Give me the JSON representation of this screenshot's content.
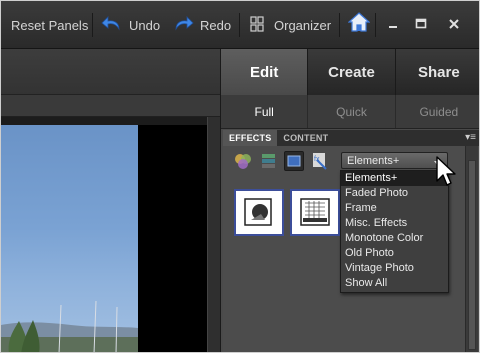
{
  "toolbar": {
    "reset_panels": "Reset Panels",
    "undo": "Undo",
    "redo": "Redo",
    "organizer": "Organizer",
    "icons": [
      "undo-icon",
      "redo-icon",
      "organizer-icon",
      "home-icon",
      "minimize-icon",
      "maximize-icon",
      "close-icon"
    ]
  },
  "main_tabs": [
    "Edit",
    "Create",
    "Share"
  ],
  "active_main_tab": "Edit",
  "sub_tabs": [
    "Full",
    "Quick",
    "Guided"
  ],
  "active_sub_tab": "Full",
  "panel_tabs": [
    "EFFECTS",
    "CONTENT"
  ],
  "active_panel_tab": "EFFECTS",
  "effects_icons": [
    "filters-icon",
    "layer-styles-icon",
    "photo-effects-icon",
    "all-effects-icon"
  ],
  "category_select": {
    "value": "Elements+",
    "options": [
      "Elements+",
      "Faded Photo",
      "Frame",
      "Misc. Effects",
      "Monotone Color",
      "Old Photo",
      "Vintage Photo",
      "Show All"
    ],
    "selected": "Elements+"
  },
  "colors": {
    "panel_bg": "#4a4a4a",
    "toolbar_bg": "#2f2f2f",
    "accent_blue": "#3c6fcf",
    "thumb_border": "#3c4e9a"
  }
}
